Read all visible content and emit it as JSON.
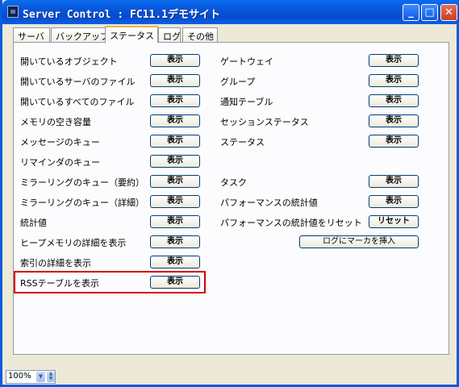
{
  "window": {
    "title": "Server Control : FC11.1デモサイト"
  },
  "tabs": [
    "サーバ",
    "バックアップ",
    "ステータス",
    "ログ",
    "その他"
  ],
  "active_tab": "ステータス",
  "left_rows": [
    {
      "label": "開いているオブジェクト",
      "button": "表示"
    },
    {
      "label": "開いているサーバのファイル",
      "button": "表示"
    },
    {
      "label": "開いているすべてのファイル",
      "button": "表示"
    },
    {
      "label": "メモリの空き容量",
      "button": "表示"
    },
    {
      "label": "メッセージのキュー",
      "button": "表示"
    },
    {
      "label": "リマインダのキュー",
      "button": "表示"
    },
    {
      "label": "ミラーリングのキュー（要約）",
      "button": "表示"
    },
    {
      "label": "ミラーリングのキュー（詳細）",
      "button": "表示"
    },
    {
      "label": "統計値",
      "button": "表示"
    },
    {
      "label": "ヒープメモリの詳細を表示",
      "button": "表示"
    },
    {
      "label": "索引の詳細を表示",
      "button": "表示"
    },
    {
      "label": "RSSテーブルを表示",
      "button": "表示"
    }
  ],
  "right_rows": [
    {
      "label": "ゲートウェイ",
      "button": "表示"
    },
    {
      "label": "グループ",
      "button": "表示"
    },
    {
      "label": "通知テーブル",
      "button": "表示"
    },
    {
      "label": "セッションステータス",
      "button": "表示"
    },
    {
      "label": "ステータス",
      "button": "表示"
    },
    {
      "label": "タスク",
      "button": "表示"
    },
    {
      "label": "パフォーマンスの統計値",
      "button": "表示"
    },
    {
      "label": "パフォーマンスの統計値をリセット",
      "button": "リセット"
    }
  ],
  "log_marker_button": "ログにマーカを挿入",
  "status_bar": {
    "zoom": "100%"
  },
  "colors": {
    "title_bar": "#0856d8",
    "highlight": "#d40000",
    "tab_accent": "#f6b33c"
  }
}
